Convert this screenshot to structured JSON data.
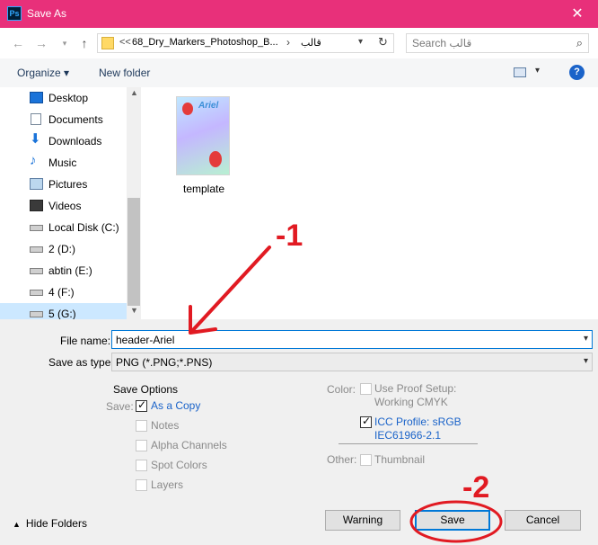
{
  "window": {
    "title": "Save As",
    "app_icon_label": "Ps",
    "close_glyph": "✕"
  },
  "address": {
    "overflow": "<<",
    "path_1": "68_Dry_Markers_Photoshop_B...",
    "separator": "›",
    "path_2": "قالب",
    "search_placeholder": "Search قالب"
  },
  "toolbar": {
    "organize_label": "Organize ▾",
    "newfolder_label": "New folder",
    "help_label": "?"
  },
  "sidebar": {
    "items": [
      {
        "label": "Desktop",
        "icon": "desktop-icon"
      },
      {
        "label": "Documents",
        "icon": "documents-icon"
      },
      {
        "label": "Downloads",
        "icon": "downloads-icon"
      },
      {
        "label": "Music",
        "icon": "music-icon"
      },
      {
        "label": "Pictures",
        "icon": "pictures-icon"
      },
      {
        "label": "Videos",
        "icon": "videos-icon"
      },
      {
        "label": "Local Disk (C:)",
        "icon": "drive-icon"
      },
      {
        "label": "2 (D:)",
        "icon": "drive-icon"
      },
      {
        "label": "abtin (E:)",
        "icon": "drive-icon"
      },
      {
        "label": "4 (F:)",
        "icon": "drive-icon"
      },
      {
        "label": "5 (G:)",
        "icon": "drive-icon"
      }
    ]
  },
  "files": [
    {
      "name": "template",
      "thumb_text": "Ariel"
    }
  ],
  "form": {
    "filename_label": "File name:",
    "filename_value": "header-Ariel",
    "savetype_label": "Save as type:",
    "savetype_value": "PNG (*.PNG;*.PNS)"
  },
  "save_options": {
    "heading": "Save Options",
    "save_label": "Save:",
    "as_copy": "As a Copy",
    "notes": "Notes",
    "alpha": "Alpha Channels",
    "spot": "Spot Colors",
    "layers": "Layers",
    "color_label": "Color:",
    "proof_1": "Use Proof Setup:",
    "proof_2": "Working CMYK",
    "icc_1": "ICC Profile:  sRGB",
    "icc_2": "IEC61966-2.1",
    "other_label": "Other:",
    "thumbnail": "Thumbnail"
  },
  "buttons": {
    "hide_folders": "Hide Folders",
    "warning": "Warning",
    "save": "Save",
    "cancel": "Cancel"
  },
  "annotations": {
    "step1": "-1",
    "step2": "-2"
  },
  "colors": {
    "titlebar": "#e8307a",
    "annotation": "#e11a22",
    "accent": "#0078d7"
  }
}
